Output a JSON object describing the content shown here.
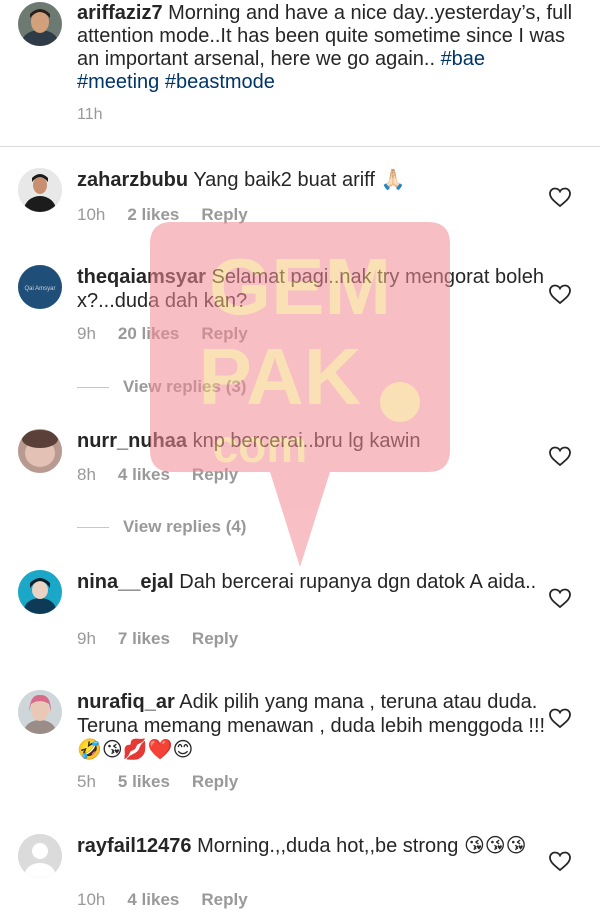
{
  "caption": {
    "username": "ariffaziz7",
    "text": " Morning and have a nice day..yesterday’s, full attention mode..It has been quite sometime since I was an important arsenal, here we go again.. ",
    "hashtags": [
      "#bae",
      "#meeting",
      "#beastmode"
    ],
    "time": "11h"
  },
  "comments": [
    {
      "username": "zaharzbubu",
      "text": " Yang baik2 buat ariff 🙏🏻",
      "time": "10h",
      "likes": "2 likes",
      "reply": "Reply"
    },
    {
      "username": "theqaiamsyar",
      "text": " Selamat pagi..nak try mengorat boleh x?...duda dah kan?",
      "time": "9h",
      "likes": "20 likes",
      "reply": "Reply",
      "view_replies": "View replies (3)",
      "avatar_label": "Qai Amsyar"
    },
    {
      "username": "nurr_nuhaa",
      "text": " knp bercerai..bru lg kawin",
      "time": "8h",
      "likes": "4 likes",
      "reply": "Reply",
      "view_replies": "View replies (4)"
    },
    {
      "username": "nina__ejal",
      "text": " Dah bercerai rupanya dgn datok A aida..",
      "time": "9h",
      "likes": "7 likes",
      "reply": "Reply"
    },
    {
      "username": "nurafiq_ar",
      "text": " Adik pilih yang mana , teruna atau duda. Teruna memang menawan , duda lebih menggoda !!! 🤣😘💋❤️😊",
      "time": "5h",
      "likes": "5 likes",
      "reply": "Reply"
    },
    {
      "username": "rayfail12476",
      "text": " Morning.,,duda hot,,be strong 😘😘😘",
      "time": "10h",
      "likes": "4 likes",
      "reply": "Reply"
    }
  ],
  "watermark": {
    "line1": "GEM",
    "line2": "PAK",
    "line3": "com",
    "color": "#f7a9ad"
  },
  "colors": {
    "hashtag": "#003569",
    "secondary": "#999999",
    "divider": "#dbdbdb"
  },
  "icons": {
    "like": "heart-icon"
  }
}
